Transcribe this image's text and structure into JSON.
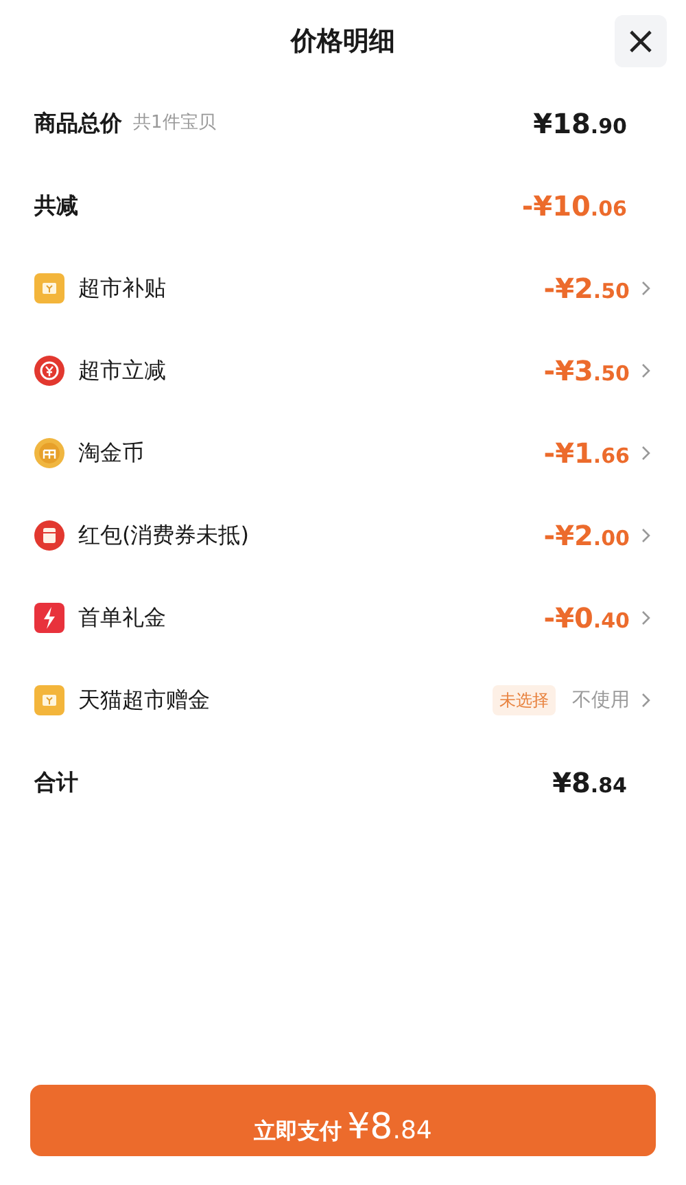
{
  "header": {
    "title": "价格明细",
    "close": "×"
  },
  "summary": [
    {
      "label": "商品总价",
      "note": "共1件宝贝",
      "main": "¥18",
      "cents": ".90",
      "color": "#1a1a1a"
    },
    {
      "label": "共减",
      "main": "-¥10",
      "cents": ".06",
      "color": "#ec6b2c"
    }
  ],
  "items": [
    {
      "kind": "subsidy",
      "label": "超市补贴",
      "main": "-¥2",
      "cents": ".50"
    },
    {
      "kind": "instant",
      "label": "超市立减",
      "main": "-¥3",
      "cents": ".50"
    },
    {
      "kind": "coins",
      "label": "淘金币",
      "main": "-¥1",
      "cents": ".66"
    },
    {
      "kind": "envelope",
      "label": "红包(消费券未抵)",
      "main": "-¥2",
      "cents": ".00"
    },
    {
      "kind": "gift",
      "label": "首单礼金",
      "main": "-¥0",
      "cents": ".40"
    },
    {
      "kind": "voucher",
      "label": "天猫超市赠金",
      "badge": "未选择",
      "status": "不使用"
    }
  ],
  "total": {
    "label": "合计",
    "main": "¥8",
    "cents": ".84"
  },
  "pay_button": {
    "label": "立即支付",
    "main": "¥8",
    "cents": ".84"
  }
}
